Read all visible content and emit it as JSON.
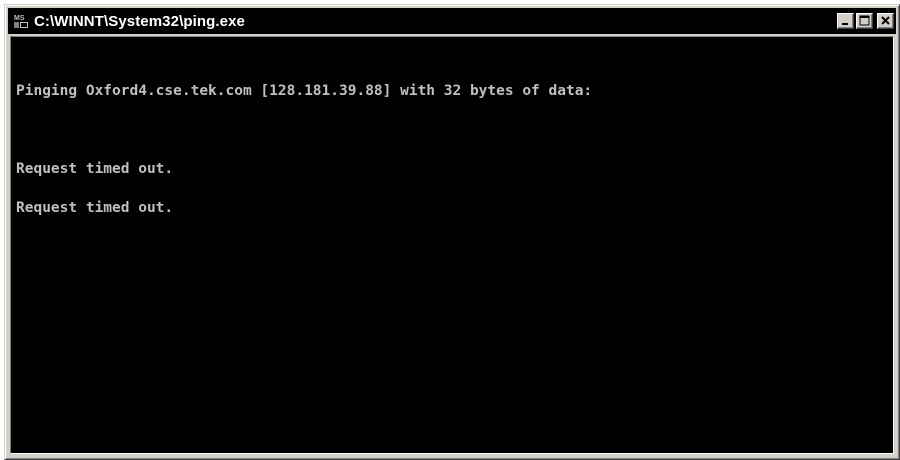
{
  "window": {
    "title": "C:\\WINNT\\System32\\ping.exe",
    "icon": "ms-dos-icon",
    "buttons": [
      "minimize",
      "maximize",
      "close"
    ]
  },
  "console": {
    "lines": [
      "Pinging Oxford4.cse.tek.com [128.181.39.88] with 32 bytes of data:",
      "",
      "Request timed out.",
      "Request timed out."
    ]
  },
  "colors": {
    "titlebar": "#000000",
    "console_background": "#000000",
    "console_text": "#c0c0c0",
    "frame": "#d4d0c8"
  }
}
